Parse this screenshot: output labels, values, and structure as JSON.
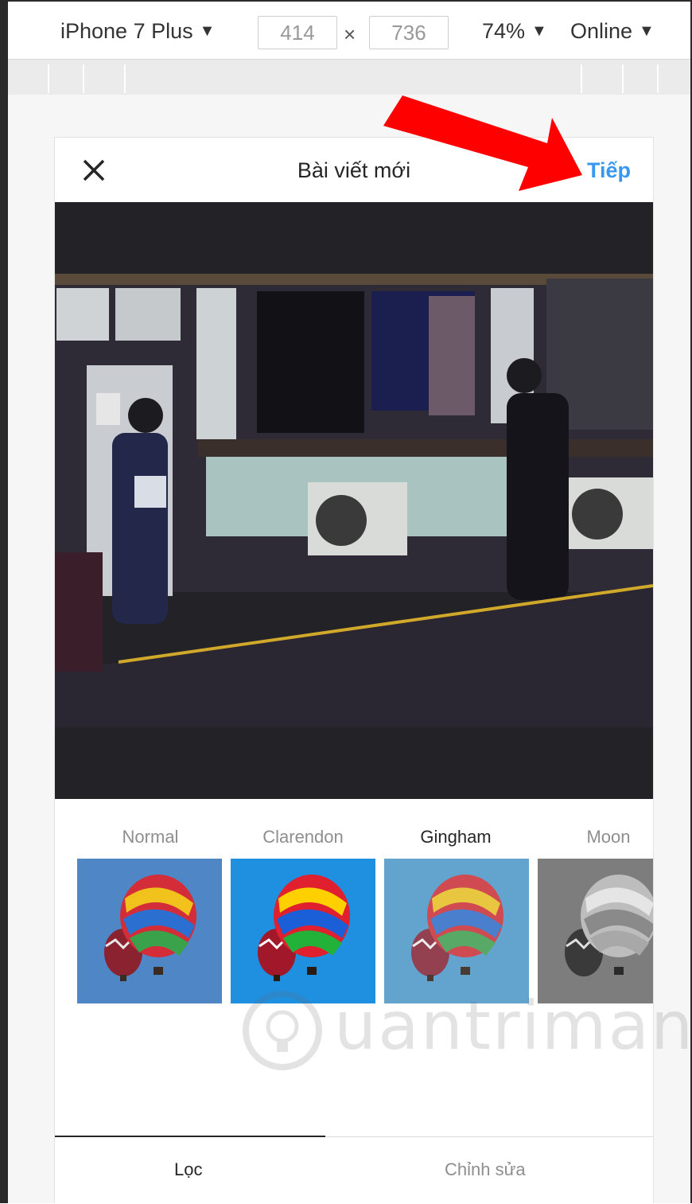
{
  "devtools": {
    "device": "iPhone 7 Plus",
    "width": "414",
    "height": "736",
    "times": "×",
    "zoom": "74%",
    "network": "Online",
    "caret": "▼"
  },
  "header": {
    "title": "Bài viết mới",
    "next_label": "Tiếp"
  },
  "filters": [
    {
      "label": "Normal",
      "active": false
    },
    {
      "label": "Clarendon",
      "active": false
    },
    {
      "label": "Gingham",
      "active": true
    },
    {
      "label": "Moon",
      "active": false
    }
  ],
  "tabs": [
    {
      "label": "Lọc",
      "active": true
    },
    {
      "label": "Chỉnh sửa",
      "active": false
    }
  ],
  "watermark": {
    "text": "uantrimang"
  },
  "annotation": {
    "arrow_color": "#ff0000"
  },
  "colors": {
    "accent": "#3897f0",
    "photo_bg": "#232227"
  },
  "icons": [
    "close-icon",
    "dropdown-caret-icon",
    "hot-air-balloon-icon",
    "bulb-logo-icon",
    "red-arrow-icon"
  ]
}
